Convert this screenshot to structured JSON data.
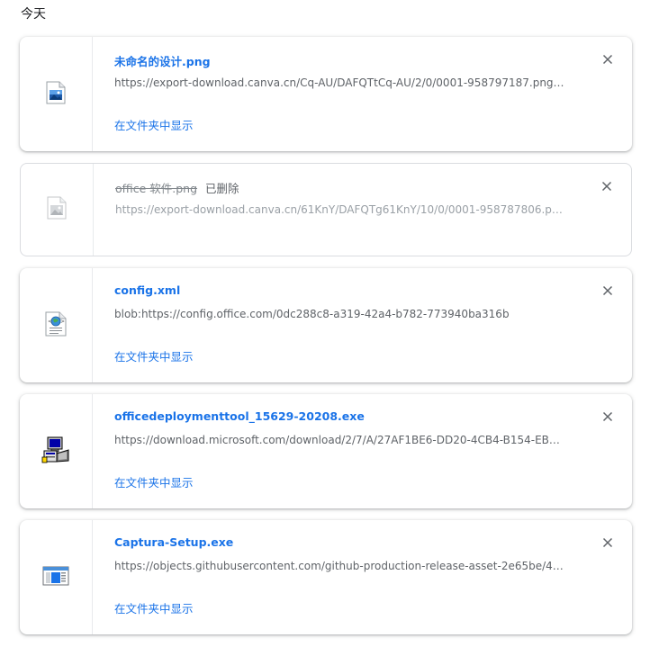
{
  "section": {
    "title": "今天"
  },
  "downloads": [
    {
      "filename": "未命名的设计.png",
      "url": "https://export-download.canva.cn/Cq-AU/DAFQTtCq-AU/2/0/0001-958797187.png?...",
      "show_in_folder": "在文件夹中显示",
      "icon": "image-file-icon"
    },
    {
      "filename": "office 软件.png",
      "status": "已删除",
      "url": "https://export-download.canva.cn/61KnY/DAFQTg61KnY/10/0/0001-958787806.png...",
      "icon": "image-file-icon-dimmed"
    },
    {
      "filename": "config.xml",
      "url": "blob:https://config.office.com/0dc288c8-a319-42a4-b782-773940ba316b",
      "show_in_folder": "在文件夹中显示",
      "icon": "xml-file-icon"
    },
    {
      "filename": "officedeploymenttool_15629-20208.exe",
      "url": "https://download.microsoft.com/download/2/7/A/27AF1BE6-DD20-4CB4-B154-EBA...",
      "show_in_folder": "在文件夹中显示",
      "icon": "installer-exe-icon"
    },
    {
      "filename": "Captura-Setup.exe",
      "url": "https://objects.githubusercontent.com/github-production-release-asset-2e65be/415...",
      "show_in_folder": "在文件夹中显示",
      "icon": "app-window-icon"
    }
  ]
}
